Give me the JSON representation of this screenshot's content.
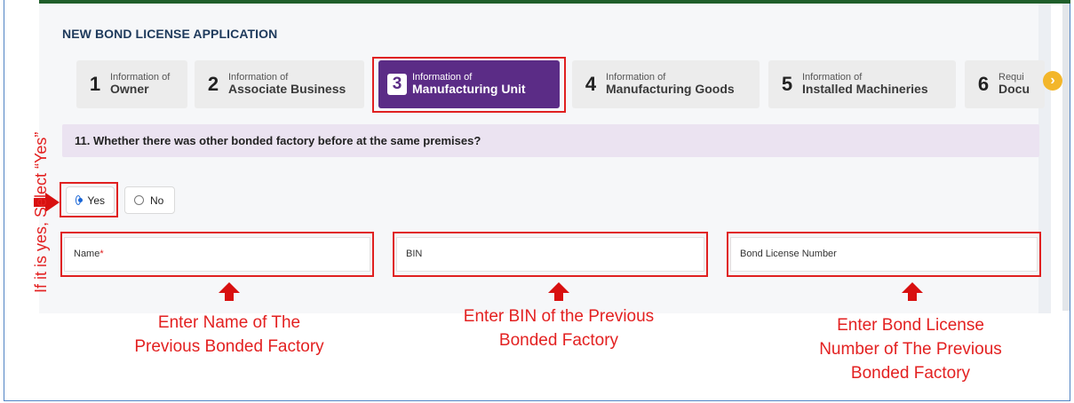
{
  "app": {
    "title": "NEW BOND LICENSE APPLICATION"
  },
  "tabs": [
    {
      "num": "1",
      "small": "Information of",
      "label": "Owner"
    },
    {
      "num": "2",
      "small": "Information of",
      "label": "Associate Business"
    },
    {
      "num": "3",
      "small": "Information of",
      "label": "Manufacturing Unit"
    },
    {
      "num": "4",
      "small": "Information of",
      "label": "Manufacturing Goods"
    },
    {
      "num": "5",
      "small": "Information of",
      "label": "Installed Machineries"
    },
    {
      "num": "6",
      "small": "Requi",
      "label": "Docu"
    }
  ],
  "active_tab": 3,
  "question": "11. Whether there was other bonded factory before at the same premises?",
  "radio": {
    "yes": "Yes",
    "no": "No",
    "selected": "Yes"
  },
  "fields": {
    "name": {
      "label": "Name",
      "required": "*"
    },
    "bin": {
      "label": "BIN"
    },
    "bond_license": {
      "label": "Bond License Number"
    }
  },
  "annotations": {
    "side": "If it is yes, Select “Yes”",
    "name_line1": "Enter Name of The",
    "name_line2": "Previous Bonded Factory",
    "bin_line1": "Enter BIN of the Previous",
    "bin_line2": "Bonded Factory",
    "bond_line1": "Enter Bond License",
    "bond_line2": "Number of The Previous",
    "bond_line3": "Bonded Factory"
  },
  "colors": {
    "active_tab": "#5b2c86",
    "annotation": "#e32121",
    "question_bg": "#ebe3f1",
    "top_bar": "#1f5e2a"
  }
}
